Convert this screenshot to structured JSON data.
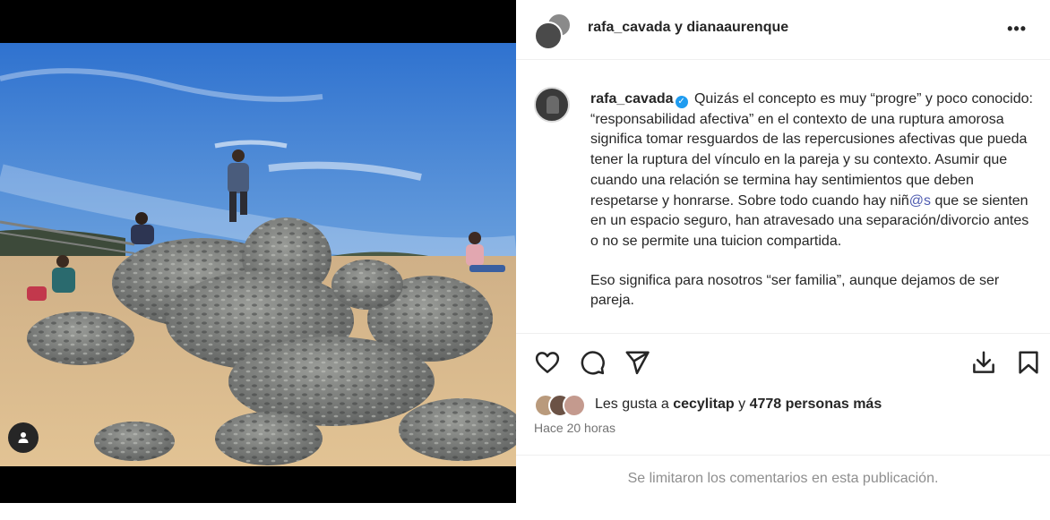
{
  "post": {
    "authors": [
      "rafa_cavada",
      "dianaaurenque"
    ],
    "authors_joiner": "y",
    "more_options": "•••"
  },
  "caption": {
    "username": "rafa_cavada",
    "verified_icon": "verified-badge-icon",
    "text_part1": "Quizás el concepto es muy “progre” y poco conocido: “responsabilidad afectiva” en el contexto de una ruptura amorosa significa tomar resguardos de las repercusiones afectivas que pueda tener la ruptura del vínculo en la pareja y su contexto. Asumir que cuando una relación se termina hay sentimientos que deben respetarse y honrarse. Sobre todo cuando hay niñ",
    "mention": "@s",
    "text_part2": " que se sienten en un espacio seguro, han atravesado una separación/divorcio antes o no se permite una tuicion compartida.",
    "paragraph2": "Eso significa para nosotros “ser familia”, aunque dejamos de ser pareja."
  },
  "actions": {
    "like_icon": "heart-icon",
    "comment_icon": "comment-icon",
    "share_icon": "send-icon",
    "download_icon": "download-icon",
    "save_icon": "bookmark-icon"
  },
  "likes": {
    "prefix": "Les gusta a",
    "user": "cecylitap",
    "joiner": "y",
    "others": "4778 personas más"
  },
  "timestamp": "Hace 20 horas",
  "comments_notice": "Se limitaron los comentarios en esta publicación.",
  "colors": {
    "mention": "#4e5bb0",
    "verified": "#1f9cf0",
    "sky": "#3b7fd4",
    "sand": "#d8b98a"
  }
}
